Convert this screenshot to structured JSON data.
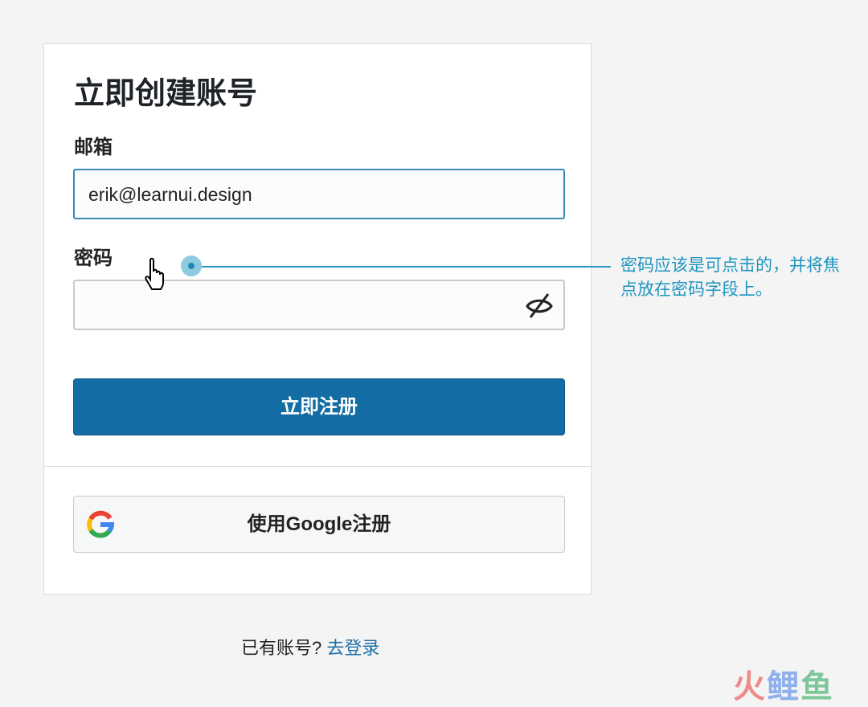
{
  "form": {
    "title": "立即创建账号",
    "email_label": "邮箱",
    "email_value": "erik@learnui.design",
    "password_label": "密码",
    "password_value": "",
    "submit_label": "立即注册",
    "google_label": "使用Google注册"
  },
  "footer": {
    "prompt": "已有账号?",
    "login_link": "去登录"
  },
  "annotation": {
    "text": "密码应该是可点击的，并将焦点放在密码字段上。"
  },
  "watermark": {
    "chars": [
      "火",
      "鲤",
      "鱼"
    ],
    "colors": [
      "#f08a8a",
      "#8fb0ea",
      "#7ec79a"
    ]
  },
  "colors": {
    "primary": "#136ca3",
    "annotation": "#1f95bf"
  }
}
